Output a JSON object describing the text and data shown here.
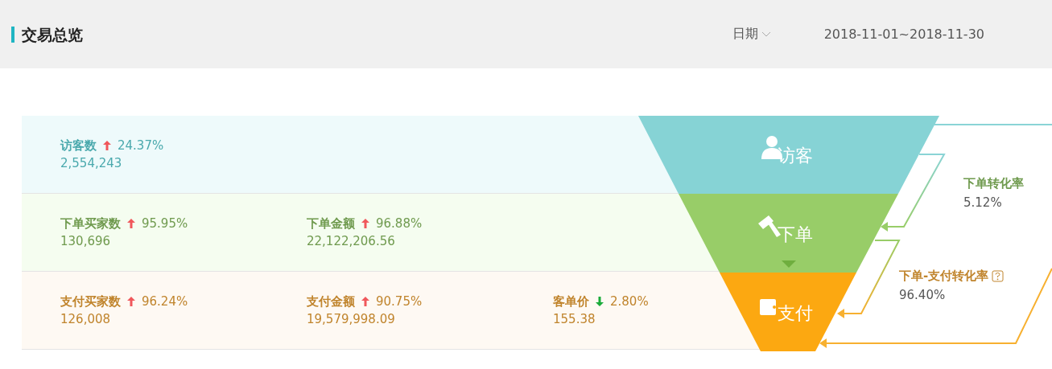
{
  "header": {
    "title": "交易总览",
    "date_label": "日期",
    "date_range": "2018-11-01~2018-11-30"
  },
  "rows": [
    {
      "kind": "visit",
      "metrics": [
        {
          "label": "访客数",
          "kind": "up",
          "change": "24.37%",
          "value": "2,554,243"
        }
      ]
    },
    {
      "kind": "order",
      "metrics": [
        {
          "label": "下单买家数",
          "kind": "up",
          "change": "95.95%",
          "value": "130,696"
        },
        {
          "label": "下单金额",
          "kind": "up",
          "change": "96.88%",
          "value": "22,122,206.56"
        }
      ]
    },
    {
      "kind": "pay",
      "metrics": [
        {
          "label": "支付买家数",
          "kind": "up",
          "change": "96.24%",
          "value": "126,008"
        },
        {
          "label": "支付金额",
          "kind": "up",
          "change": "90.75%",
          "value": "19,579,998.09"
        },
        {
          "label": "客单价",
          "kind": "down",
          "change": "2.80%",
          "value": "155.38"
        }
      ]
    }
  ],
  "funnel": [
    {
      "kind": "visit",
      "label": "访客"
    },
    {
      "kind": "order",
      "label": "下单"
    },
    {
      "kind": "pay",
      "label": "支付"
    }
  ],
  "rates": [
    {
      "kind": "order",
      "label": "下单转化率",
      "value": "5.12%",
      "help": false
    },
    {
      "kind": "pay",
      "label": "下单-支付转化率",
      "value": "96.40%",
      "help": true
    }
  ]
}
